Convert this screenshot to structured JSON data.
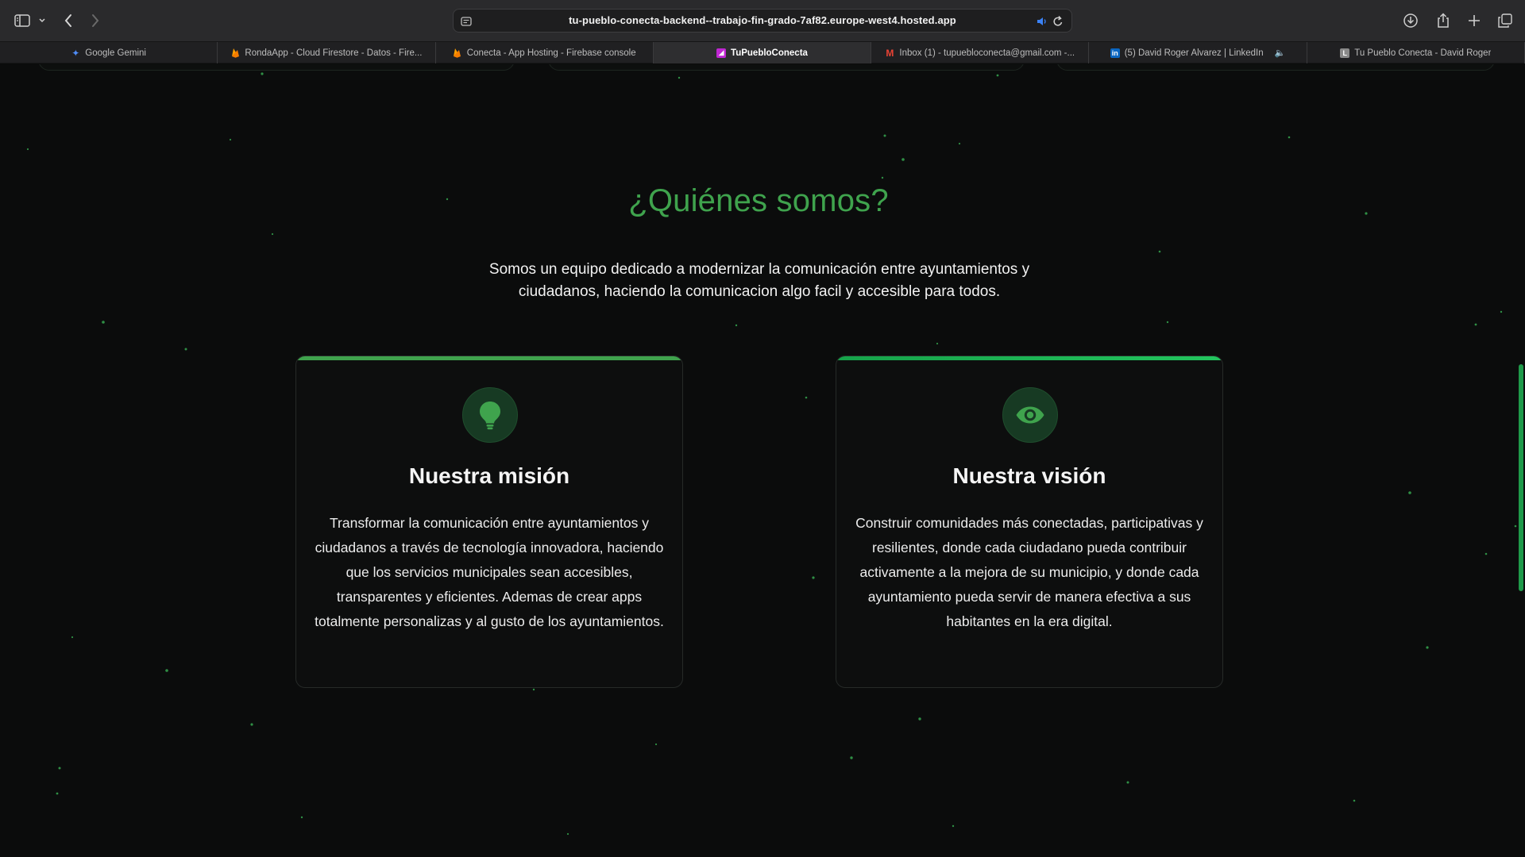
{
  "browser": {
    "url": "tu-pueblo-conecta-backend--trabajo-fin-grado-7af82.europe-west4.hosted.app",
    "tabs": [
      {
        "label": "Google Gemini",
        "icon": "gemini-icon",
        "color": "#4f8cf7",
        "active": false
      },
      {
        "label": "RondaApp - Cloud Firestore - Datos - Fire...",
        "icon": "firebase-icon",
        "color": "#f57c00",
        "active": false
      },
      {
        "label": "Conecta - App Hosting - Firebase console",
        "icon": "firebase-icon",
        "color": "#f57c00",
        "active": false
      },
      {
        "label": "TuPuebloConecta",
        "icon": "app-icon",
        "color": "#c026d3",
        "active": true
      },
      {
        "label": "Inbox (1) - tupuebloconecta@gmail.com -...",
        "icon": "gmail-icon",
        "color": "#ea4335",
        "active": false
      },
      {
        "label": "(5) David Roger Alvarez | LinkedIn",
        "icon": "linkedin-icon",
        "color": "#0a66c2",
        "active": false,
        "muted": true
      },
      {
        "label": "Tu Pueblo Conecta - David Roger",
        "icon": "letter-l-icon",
        "color": "#8a8a8a",
        "active": false
      }
    ]
  },
  "section": {
    "title": "¿Quiénes somos?",
    "subtitle": "Somos un equipo dedicado a modernizar la comunicación entre ayuntamientos y ciudadanos, haciendo la comunicacion algo facil y accesible para todos."
  },
  "cards": [
    {
      "icon": "lightbulb-icon",
      "title": "Nuestra misión",
      "text": "Transformar la comunicación entre ayuntamientos y ciudadanos a través de tecnología innovadora, haciendo que los servicios municipales sean accesibles, transparentes y eficientes. Ademas de crear apps totalmente personalizas y al gusto de los ayuntamientos.",
      "accent": "#3fa34d"
    },
    {
      "icon": "eye-icon",
      "title": "Nuestra visión",
      "text": "Construir comunidades más conectadas, participativas y resilientes, donde cada ciudadano pueda contribuir activamente a la mejora de su municipio, y donde cada ayuntamiento pueda servir de manera efectiva a sus habitantes en la era digital.",
      "accent": "#22c55e"
    }
  ],
  "colors": {
    "accent_green": "#3fa34d",
    "bright_green": "#22c55e",
    "background": "#0b0c0c"
  }
}
